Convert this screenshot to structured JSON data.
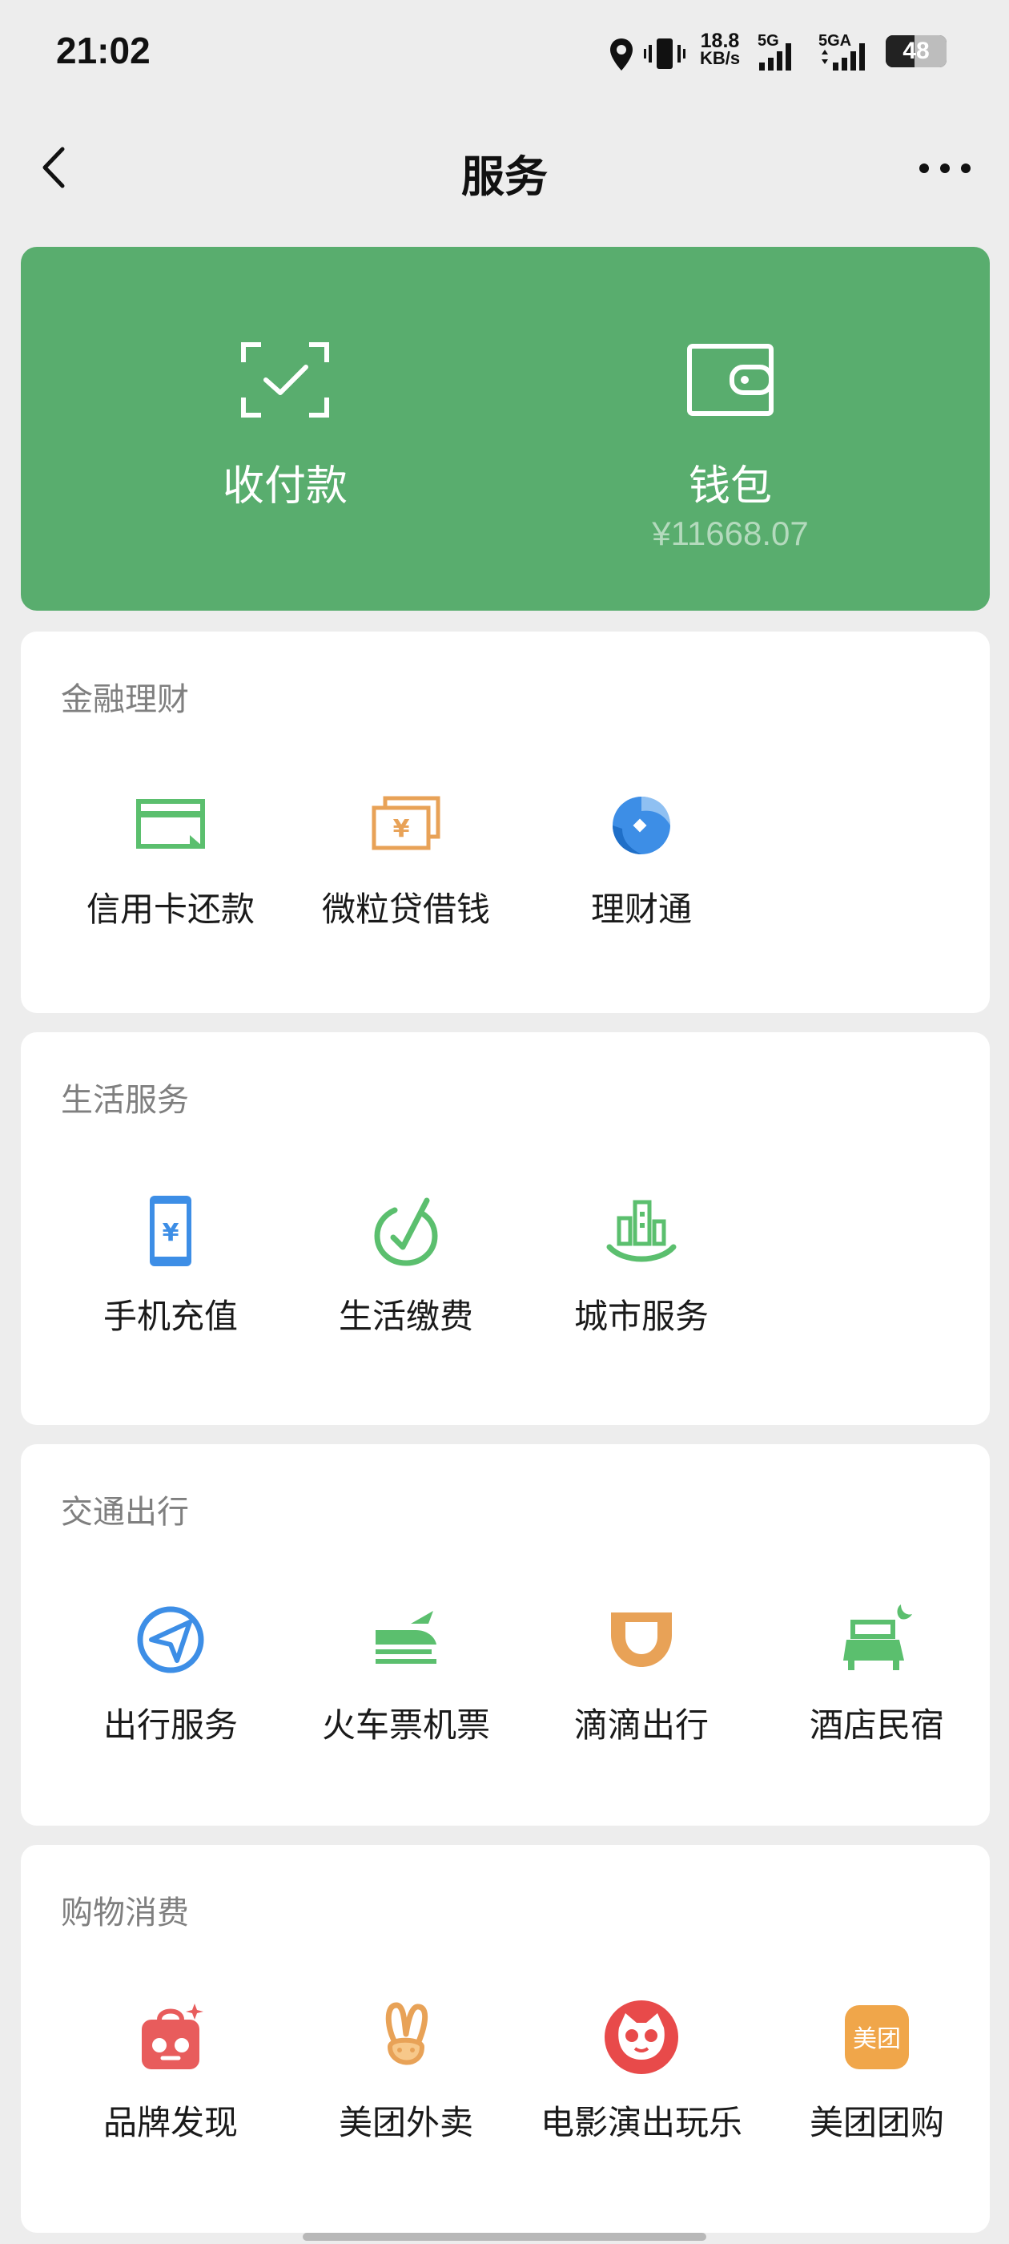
{
  "status_bar": {
    "time": "21:02",
    "net_speed_value": "18.8",
    "net_speed_unit": "KB/s",
    "sim1": "5G",
    "sim2": "5GA",
    "battery": "48",
    "battery_level_percent": 48
  },
  "nav": {
    "title": "服务"
  },
  "wallet_card": {
    "color": "#59ad6e",
    "pay": {
      "label": "收付款",
      "icon": "scan-check-icon"
    },
    "wallet": {
      "label": "钱包",
      "balance": "¥11668.07",
      "icon": "wallet-icon"
    }
  },
  "sections": [
    {
      "title": "金融理财",
      "items": [
        {
          "label": "信用卡还款",
          "icon": "credit-card-icon",
          "color": "#5bbf6e"
        },
        {
          "label": "微粒贷借钱",
          "icon": "yuan-bills-icon",
          "color": "#e8a257"
        },
        {
          "label": "理财通",
          "icon": "wealth-drop-icon",
          "color": "#3d8ee6"
        }
      ]
    },
    {
      "title": "生活服务",
      "items": [
        {
          "label": "手机充值",
          "icon": "phone-yuan-icon",
          "color": "#3d8ee6"
        },
        {
          "label": "生活缴费",
          "icon": "check-circle-icon",
          "color": "#5bbf6e"
        },
        {
          "label": "城市服务",
          "icon": "city-buildings-icon",
          "color": "#5bbf6e"
        }
      ]
    },
    {
      "title": "交通出行",
      "items": [
        {
          "label": "出行服务",
          "icon": "navigation-arrow-icon",
          "color": "#3d8ee6"
        },
        {
          "label": "火车票机票",
          "icon": "train-plane-icon",
          "color": "#5bbf6e"
        },
        {
          "label": "滴滴出行",
          "icon": "didi-icon",
          "color": "#e8a257"
        },
        {
          "label": "酒店民宿",
          "icon": "hotel-bed-icon",
          "color": "#5bbf6e"
        }
      ]
    },
    {
      "title": "购物消费",
      "items": [
        {
          "label": "品牌发现",
          "icon": "shopping-bag-icon",
          "color": "#e85c5c"
        },
        {
          "label": "美团外卖",
          "icon": "rabbit-icon",
          "color": "#e8a257"
        },
        {
          "label": "电影演出玩乐",
          "icon": "cat-eye-icon",
          "color": "#e84a4a"
        },
        {
          "label": "美团团购",
          "icon": "meituan-icon",
          "color": "#f0a64a",
          "badge": "美团"
        }
      ]
    }
  ]
}
